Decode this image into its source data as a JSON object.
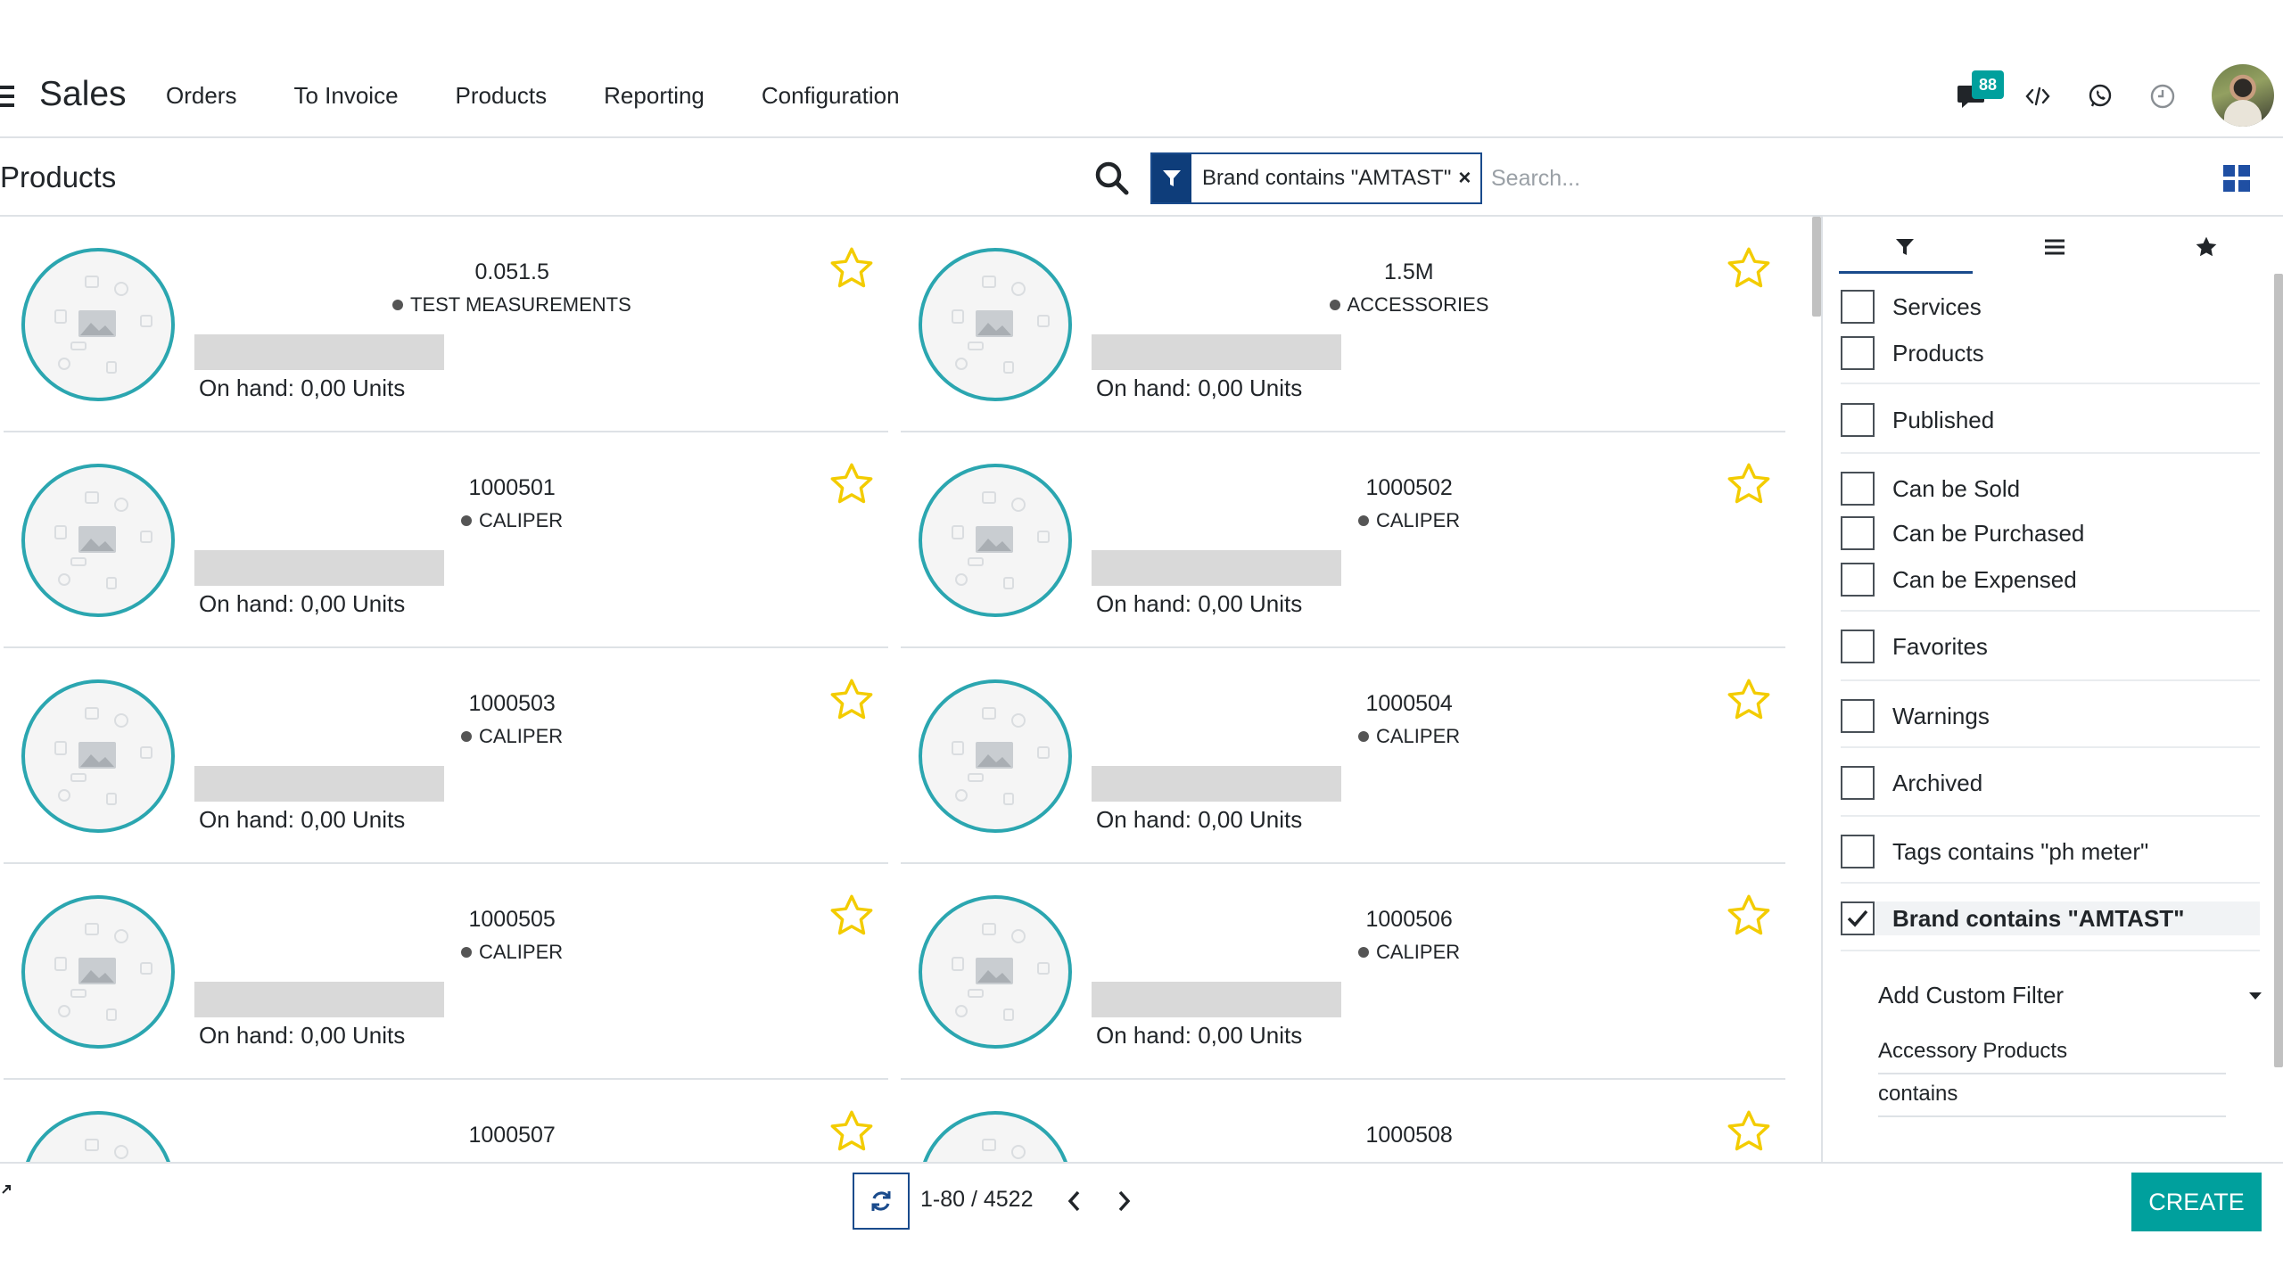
{
  "navbar": {
    "app_title": "Sales",
    "menu": [
      "Orders",
      "To Invoice",
      "Products",
      "Reporting",
      "Configuration"
    ],
    "chat_badge": "88",
    "icons": [
      "menu-icon",
      "chat-icon",
      "code-icon",
      "whatsapp-icon",
      "clock-icon"
    ]
  },
  "control_panel": {
    "breadcrumb": "Products",
    "facet_label": "Brand contains \"AMTAST\"",
    "facet_remove": "×",
    "search_placeholder": "Search..."
  },
  "cards": [
    {
      "ref": "0.051.5",
      "tag": "TEST MEASUREMENTS",
      "onhand": "On hand: 0,00 Units"
    },
    {
      "ref": "1.5M",
      "tag": "ACCESSORIES",
      "onhand": "On hand: 0,00 Units"
    },
    {
      "ref": "1000501",
      "tag": "CALIPER",
      "onhand": "On hand: 0,00 Units"
    },
    {
      "ref": "1000502",
      "tag": "CALIPER",
      "onhand": "On hand: 0,00 Units"
    },
    {
      "ref": "1000503",
      "tag": "CALIPER",
      "onhand": "On hand: 0,00 Units"
    },
    {
      "ref": "1000504",
      "tag": "CALIPER",
      "onhand": "On hand: 0,00 Units"
    },
    {
      "ref": "1000505",
      "tag": "CALIPER",
      "onhand": "On hand: 0,00 Units"
    },
    {
      "ref": "1000506",
      "tag": "CALIPER",
      "onhand": "On hand: 0,00 Units"
    },
    {
      "ref": "1000507",
      "tag": "",
      "onhand": ""
    },
    {
      "ref": "1000508",
      "tag": "",
      "onhand": ""
    }
  ],
  "filter_panel": {
    "filters": [
      {
        "label": "Services",
        "checked": false
      },
      {
        "label": "Products",
        "checked": false
      },
      {
        "label": "Published",
        "checked": false
      },
      {
        "label": "Can be Sold",
        "checked": false
      },
      {
        "label": "Can be Purchased",
        "checked": false
      },
      {
        "label": "Can be Expensed",
        "checked": false
      },
      {
        "label": "Favorites",
        "checked": false
      },
      {
        "label": "Warnings",
        "checked": false
      },
      {
        "label": "Archived",
        "checked": false
      },
      {
        "label": "Tags contains \"ph meter\"",
        "checked": false
      },
      {
        "label": "Brand contains \"AMTAST\"",
        "checked": true
      }
    ],
    "add_custom_filter": "Add Custom Filter",
    "custom_field": "Accessory Products",
    "custom_operator": "contains"
  },
  "footer": {
    "pager_value": "1-80 / 4522",
    "create_label": "CREATE"
  },
  "colors": {
    "accent": "#00a09d",
    "facet_blue": "#0e3d7a",
    "star": "#f3cc00",
    "image_ring": "#2ba6b0"
  }
}
